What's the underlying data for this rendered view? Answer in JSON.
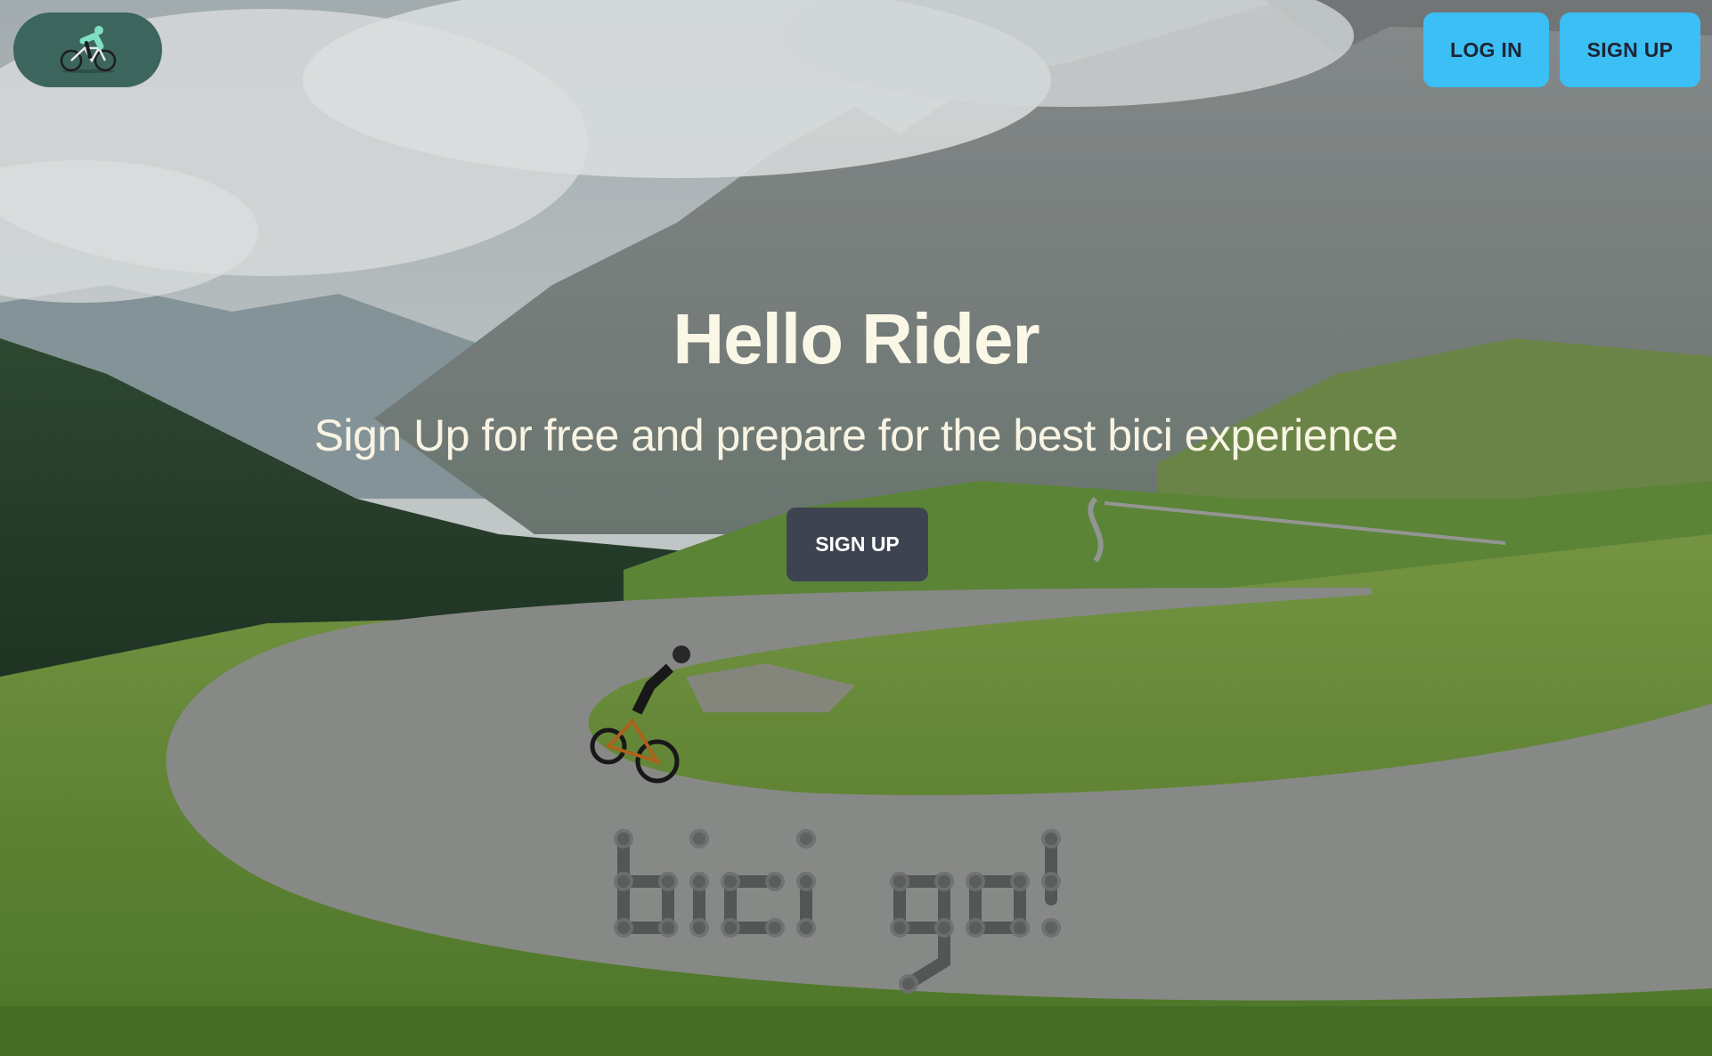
{
  "brand": {
    "logo_icon": "cyclist-icon",
    "wordmark": "bici go!"
  },
  "nav": {
    "login_label": "LOG IN",
    "signup_label": "SIGN UP"
  },
  "hero": {
    "headline": "Hello Rider",
    "subheadline": "Sign Up for free and prepare for the best bici experience",
    "cta_label": "SIGN UP"
  },
  "colors": {
    "nav_button": "#3bbff5",
    "cta_button": "#3e4352",
    "logo_pill": "#3c655e",
    "headline_text": "#fbf7e6"
  }
}
